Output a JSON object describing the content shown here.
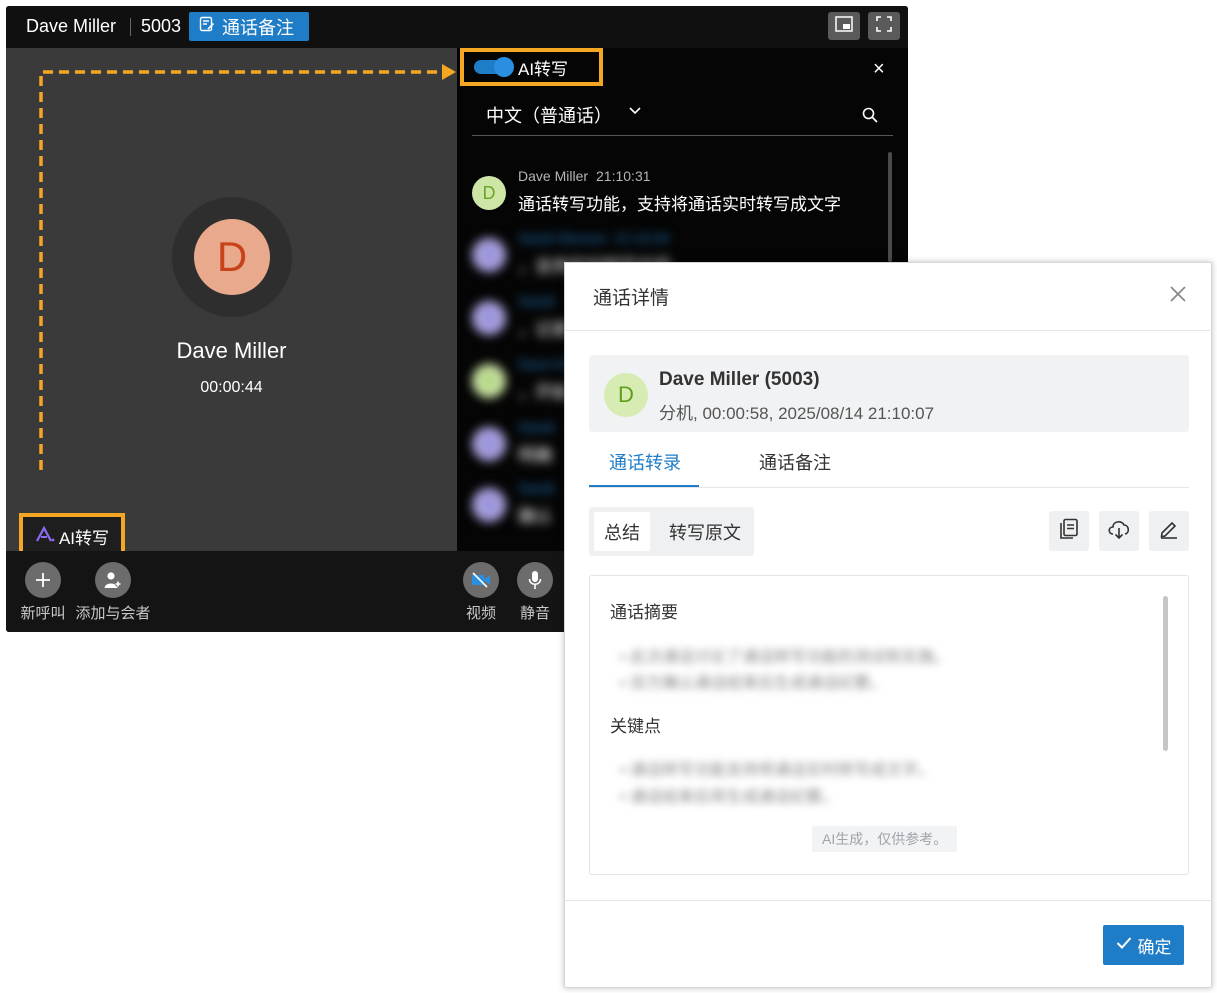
{
  "call_window": {
    "title_name": "Dave Miller",
    "title_ext": "5003",
    "note_button": "通话备注",
    "caller": {
      "initial": "D",
      "name": "Dave Miller",
      "timer": "00:00:44"
    },
    "ai_button": "AI转写",
    "controls": {
      "new_call": "新呼叫",
      "add_participant": "添加与会者",
      "video": "视频",
      "mute": "静音"
    }
  },
  "transcript_panel": {
    "toggle_label": "AI转写",
    "toggle_on": true,
    "close": "×",
    "language": "中文（普通话）",
    "messages": [
      {
        "initial": "D",
        "speaker": "Dave Miller",
        "time": "21:10:31",
        "text": "通话转写功能，支持将通话实时转写成文字",
        "color": "#cde6a6",
        "text_color": "#6aa525",
        "blurred": false
      },
      {
        "initial": "S",
        "speaker": "Sarah Benson",
        "time": "21:10:34",
        "text": "，支持实时转写内容",
        "color": "#a9a3e0",
        "text_color": "#6b62c7",
        "blurred": true
      },
      {
        "initial": "S",
        "speaker": "Sarah",
        "time": "",
        "text": "，记录",
        "color": "#a9a3e0",
        "text_color": "#6b62c7",
        "blurred": true
      },
      {
        "initial": "D",
        "speaker": "Dave M",
        "time": "",
        "text": "，开始",
        "color": "#cde6a6",
        "text_color": "#6aa525",
        "blurred": true
      },
      {
        "initial": "S",
        "speaker": "Sarah",
        "time": "",
        "text": "明确",
        "color": "#a9a3e0",
        "text_color": "#6b62c7",
        "blurred": true
      },
      {
        "initial": "S",
        "speaker": "Sarah",
        "time": "",
        "text": "确认",
        "color": "#a9a3e0",
        "text_color": "#6b62c7",
        "blurred": true
      }
    ]
  },
  "dialog": {
    "title": "通话详情",
    "contact": {
      "initial": "D",
      "name": "Dave Miller (5003)",
      "details": "分机, 00:00:58, 2025/08/14 21:10:07"
    },
    "tabs": [
      {
        "label": "通话转录",
        "active": true
      },
      {
        "label": "通话备注",
        "active": false
      }
    ],
    "segments": [
      {
        "label": "总结",
        "active": true
      },
      {
        "label": "转写原文",
        "active": false
      }
    ],
    "summary": {
      "heading1": "通话摘要",
      "items1": [
        "此次通话讨论了通话转写功能的测试和实施。",
        "双方确认通话结束后生成通话纪要。"
      ],
      "heading2": "关键点",
      "items2": [
        "通话转写功能支持将通话实时转写成文字。",
        "通话结束后将生成通话纪要。"
      ],
      "ai_note": "AI生成，仅供参考。"
    },
    "ok_button": "确定"
  },
  "colors": {
    "accent": "#1f7dc8",
    "highlight": "#f5a623"
  }
}
